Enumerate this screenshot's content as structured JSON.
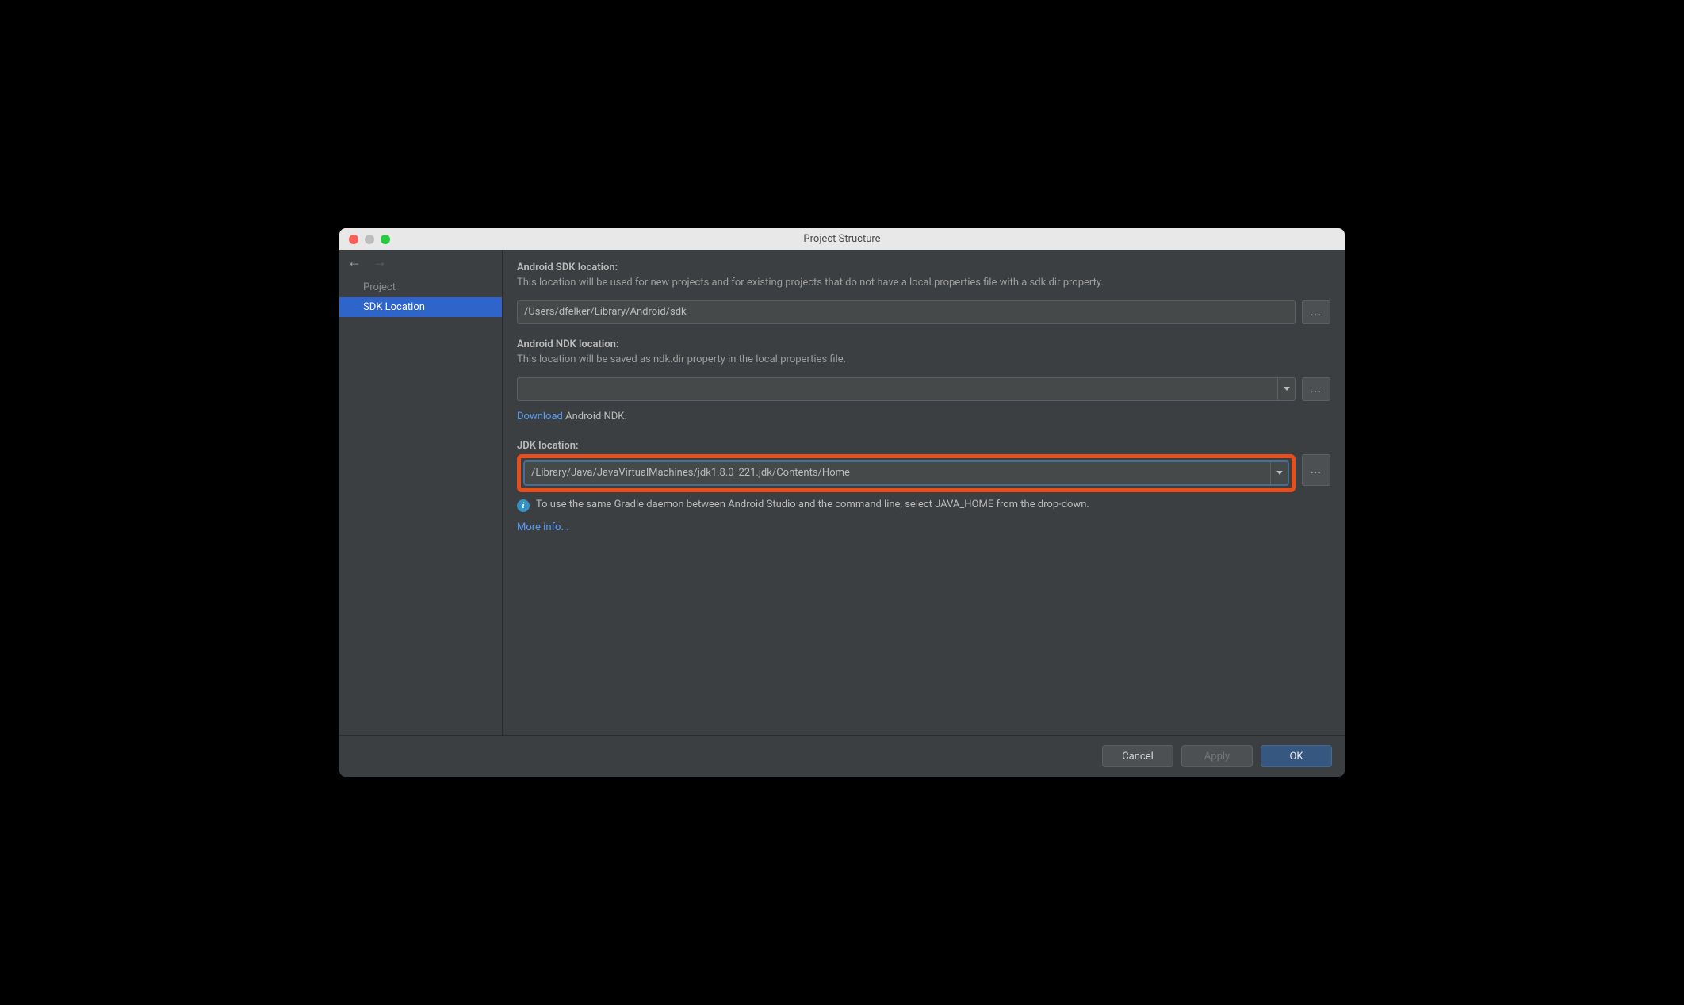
{
  "window": {
    "title": "Project Structure"
  },
  "sidebar": {
    "items": [
      {
        "label": "Project",
        "selected": false
      },
      {
        "label": "SDK Location",
        "selected": true
      }
    ]
  },
  "sdk": {
    "title": "Android SDK location:",
    "desc": "This location will be used for new projects and for existing projects that do not have a local.properties file with a sdk.dir property.",
    "value": "/Users/dfelker/Library/Android/sdk",
    "browse": "..."
  },
  "ndk": {
    "title": "Android NDK location:",
    "desc": "This location will be saved as ndk.dir property in the local.properties file.",
    "value": "",
    "browse": "...",
    "download_link": "Download",
    "download_text": " Android NDK."
  },
  "jdk": {
    "title": "JDK location:",
    "value": "/Library/Java/JavaVirtualMachines/jdk1.8.0_221.jdk/Contents/Home",
    "browse": "...",
    "info_text": "To use the same Gradle daemon between Android Studio and the command line, select JAVA_HOME from the drop-down.",
    "more_info": "More info..."
  },
  "footer": {
    "cancel": "Cancel",
    "apply": "Apply",
    "ok": "OK"
  }
}
